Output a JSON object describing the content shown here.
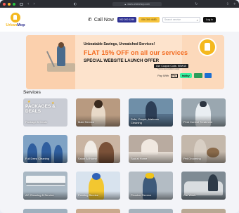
{
  "browser": {
    "url": "www.urbanmop.com"
  },
  "navbar": {
    "logo_urban": "Urban",
    "logo_mop": "Mop",
    "call_label": "Call Now",
    "phone_button": "052 200 0299",
    "whatsapp_button": "056 390 4683",
    "search_placeholder": "Search service",
    "login_button": "Log In"
  },
  "banner": {
    "tagline": "Unbeatable Savings, Unmatched Services!",
    "flat_offer": "FLAT 15% OFF on all our services",
    "special_offer": "SPECIAL WEBSITE LAUNCH OFFER",
    "coupon": "Use Coupon Code- NEW15",
    "coupon_note": "*Terms and conditions apply",
    "pay_with": "Pay With",
    "apple_pay": "Pay",
    "tabby": "tabby"
  },
  "services": {
    "title": "Services",
    "items": [
      {
        "label": "Package & Deals",
        "headline": "PACKAGES & DEALS"
      },
      {
        "label": "Maid Service"
      },
      {
        "label": "Sofa, Carpet, Mattress Cleaning"
      },
      {
        "label": "Pest Control Treatment"
      },
      {
        "label": "Full Deep Cleaning"
      },
      {
        "label": "Salon At Home"
      },
      {
        "label": "Spa at Home"
      },
      {
        "label": "Pet Grooming"
      },
      {
        "label": "AC Cleaning & Service"
      },
      {
        "label": "Painting Service"
      },
      {
        "label": "Plumber Service"
      },
      {
        "label": "Car Wash"
      }
    ]
  },
  "colors": {
    "brand_yellow": "#f4b81e",
    "brand_navy": "#2e3192",
    "offer_orange": "#f36c21"
  }
}
